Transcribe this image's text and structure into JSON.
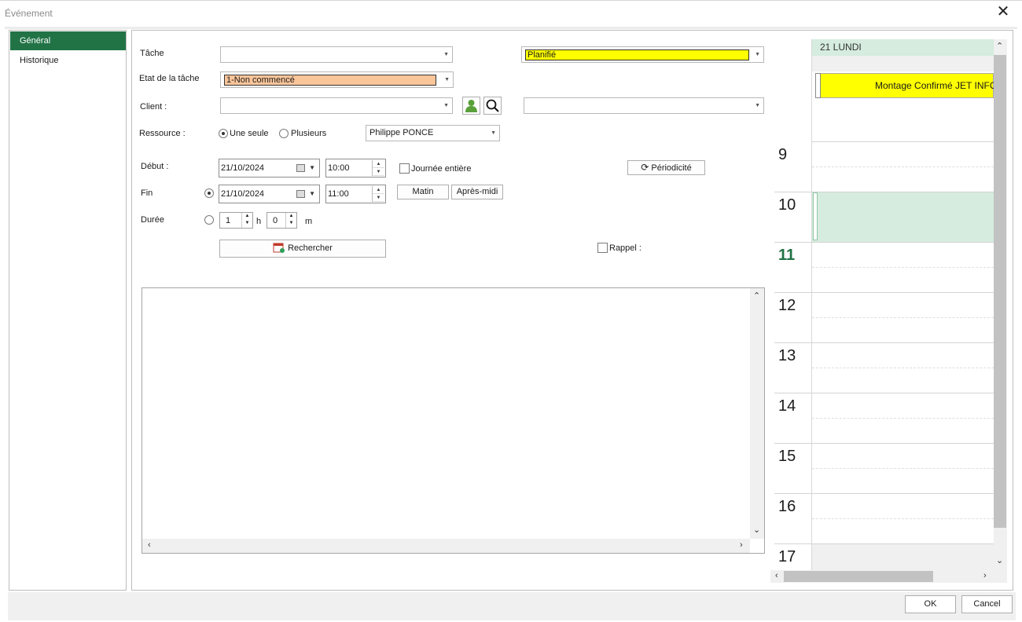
{
  "window": {
    "title": "Événement",
    "close_glyph": "✕"
  },
  "nav": {
    "items": [
      {
        "label": "Général",
        "active": true
      },
      {
        "label": "Historique",
        "active": false
      }
    ]
  },
  "form": {
    "tache_label": "Tâche",
    "tache_value": "",
    "statut_value": "Planifié",
    "etat_label": "Etat de la tâche",
    "etat_value": "1-Non commencé",
    "client_label": "Client :",
    "client_value": "",
    "client_contact_value": "",
    "ressource_label": "Ressource :",
    "ressource_option_single": "Une seule",
    "ressource_option_multi": "Plusieurs",
    "ressource_value": "Philippe PONCE",
    "debut_label": "Début :",
    "debut_date": "21/10/2024",
    "debut_time": "10:00",
    "journee_entiere_label": "Journée entière",
    "periodicite_label": "Périodicité",
    "fin_label": "Fin",
    "fin_date": "21/10/2024",
    "fin_time": "11:00",
    "matin_label": "Matin",
    "apres_midi_label": "Après-midi",
    "duree_label": "Durée",
    "duree_hours": "1",
    "hours_unit": "h",
    "duree_minutes": "0",
    "minutes_unit": "m",
    "rechercher_label": "Rechercher",
    "rappel_label": "Rappel :",
    "notes_value": ""
  },
  "calendar": {
    "day_header": "21 LUNDI",
    "event_title": "Montage Confirmé JET INFO",
    "hours": [
      "9",
      "10",
      "11",
      "12",
      "13",
      "14",
      "15",
      "16",
      "17"
    ],
    "current_hour": "11"
  },
  "footer": {
    "ok_label": "OK",
    "cancel_label": "Cancel"
  },
  "colors": {
    "accent": "#217346",
    "highlight_yellow": "#ffff00",
    "etat_orange": "#fbc59a",
    "calendar_selection": "#d5ecde"
  }
}
